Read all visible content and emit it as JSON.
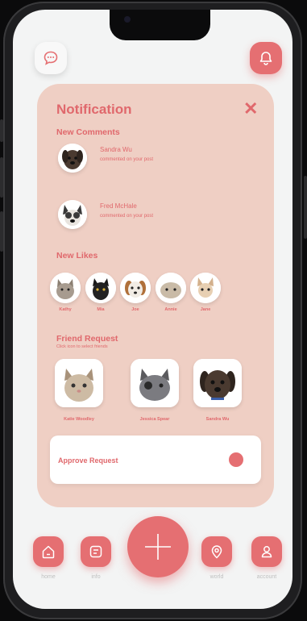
{
  "colors": {
    "accent": "#e56f72",
    "card": "#efcfc4",
    "screen": "#f3f4f4"
  },
  "header": {
    "chat_icon": "chat-bubble-icon",
    "bell_icon": "bell-icon"
  },
  "notification": {
    "title": "Notification",
    "close_label": "✕",
    "new_comments": {
      "title": "New Comments",
      "items": [
        {
          "name": "Sandra Wu",
          "action": "commented on your post"
        },
        {
          "name": "Fred McHale",
          "action": "commented on your post"
        }
      ]
    },
    "new_likes": {
      "title": "New Likes",
      "items": [
        {
          "name": "Kathy"
        },
        {
          "name": "Mia"
        },
        {
          "name": "Joe"
        },
        {
          "name": "Annie"
        },
        {
          "name": "Jane"
        }
      ]
    },
    "friend_request": {
      "title": "Friend Request",
      "hint": "Click icon to select friends",
      "items": [
        {
          "name": "Katie Woodley"
        },
        {
          "name": "Jessica Spear"
        },
        {
          "name": "Sandra Wu"
        }
      ]
    },
    "approve_label": "Approve Request"
  },
  "nav": {
    "home": "home",
    "info": "info",
    "world": "world",
    "account": "account"
  }
}
